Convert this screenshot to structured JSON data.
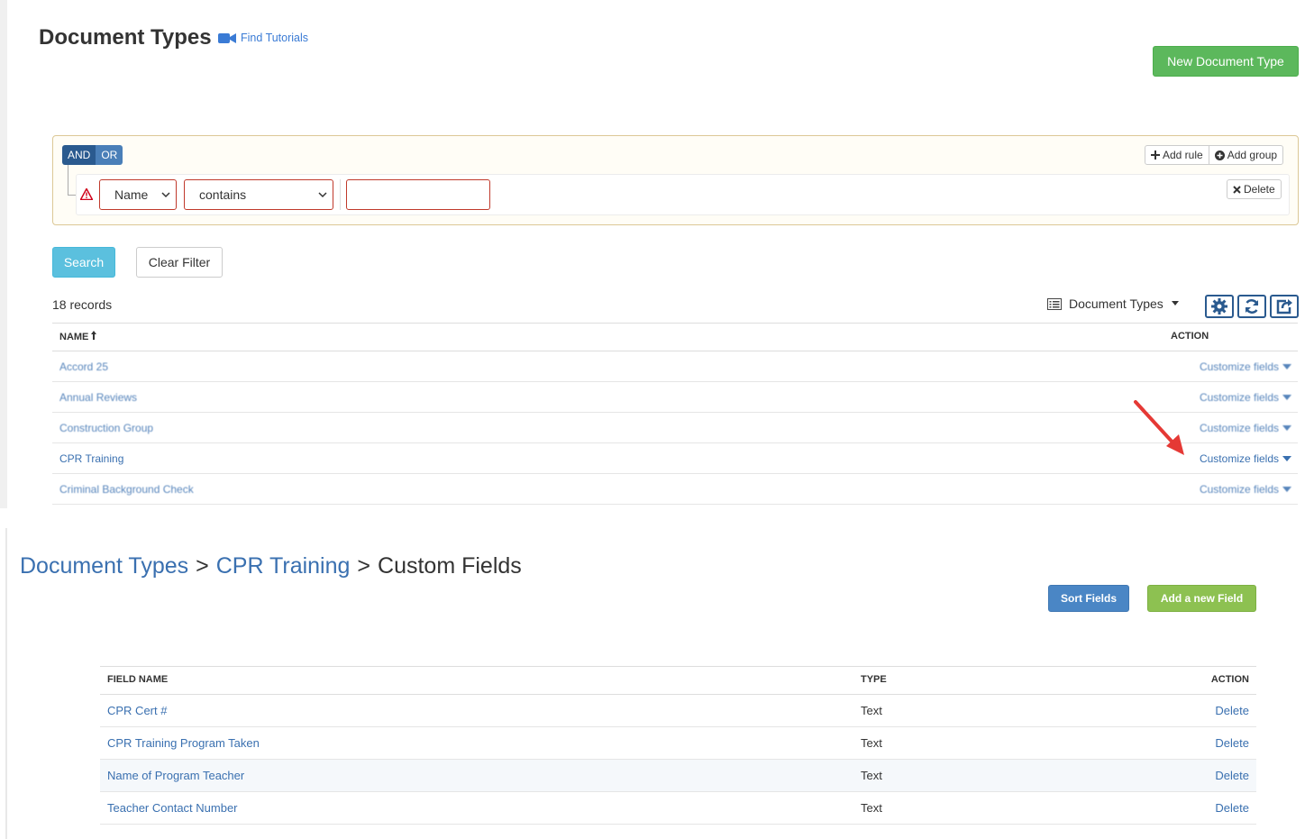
{
  "top": {
    "page_title": "Document Types",
    "tutorials_label": "Find Tutorials",
    "new_button": "New Document Type",
    "query_builder": {
      "and_label": "AND",
      "or_label": "OR",
      "add_rule": "Add rule",
      "add_group": "Add group",
      "field_select": "Name",
      "operator_select": "contains",
      "value": "",
      "delete_label": "Delete"
    },
    "search_button": "Search",
    "clear_button": "Clear Filter",
    "records_count": "18 records",
    "view_select": "Document Types",
    "table": {
      "col_name": "NAME",
      "col_action": "ACTION",
      "rows": [
        {
          "name": "Accord 25",
          "action": "Customize fields"
        },
        {
          "name": "Annual Reviews",
          "action": "Customize fields"
        },
        {
          "name": "Construction Group",
          "action": "Customize fields"
        },
        {
          "name": "CPR Training",
          "action": "Customize fields"
        },
        {
          "name": "Criminal Background Check",
          "action": "Customize fields"
        }
      ]
    }
  },
  "bottom": {
    "breadcrumb": {
      "root": "Document Types",
      "sep1": ">",
      "current_type": "CPR Training",
      "sep2": ">",
      "page": "Custom Fields"
    },
    "sort_button": "Sort Fields",
    "add_button": "Add a new Field",
    "table": {
      "col_field": "FIELD NAME",
      "col_type": "TYPE",
      "col_action": "ACTION",
      "rows": [
        {
          "field": "CPR Cert #",
          "type": "Text",
          "action": "Delete"
        },
        {
          "field": "CPR Training Program Taken",
          "type": "Text",
          "action": "Delete"
        },
        {
          "field": "Name of Program Teacher",
          "type": "Text",
          "action": "Delete"
        },
        {
          "field": "Teacher Contact Number",
          "type": "Text",
          "action": "Delete"
        }
      ]
    }
  },
  "colors": {
    "link": "#3a70b0",
    "success": "#5cb85c",
    "info": "#5bc0de",
    "primary": "#4a86c5",
    "annotation_arrow": "#e53935"
  },
  "icons": [
    "video-camera-icon",
    "plus-icon",
    "plus-circle-icon",
    "warning-icon",
    "times-icon",
    "list-icon",
    "gear-icon",
    "refresh-icon",
    "share-icon",
    "caret-down-icon",
    "sort-asc-icon"
  ]
}
